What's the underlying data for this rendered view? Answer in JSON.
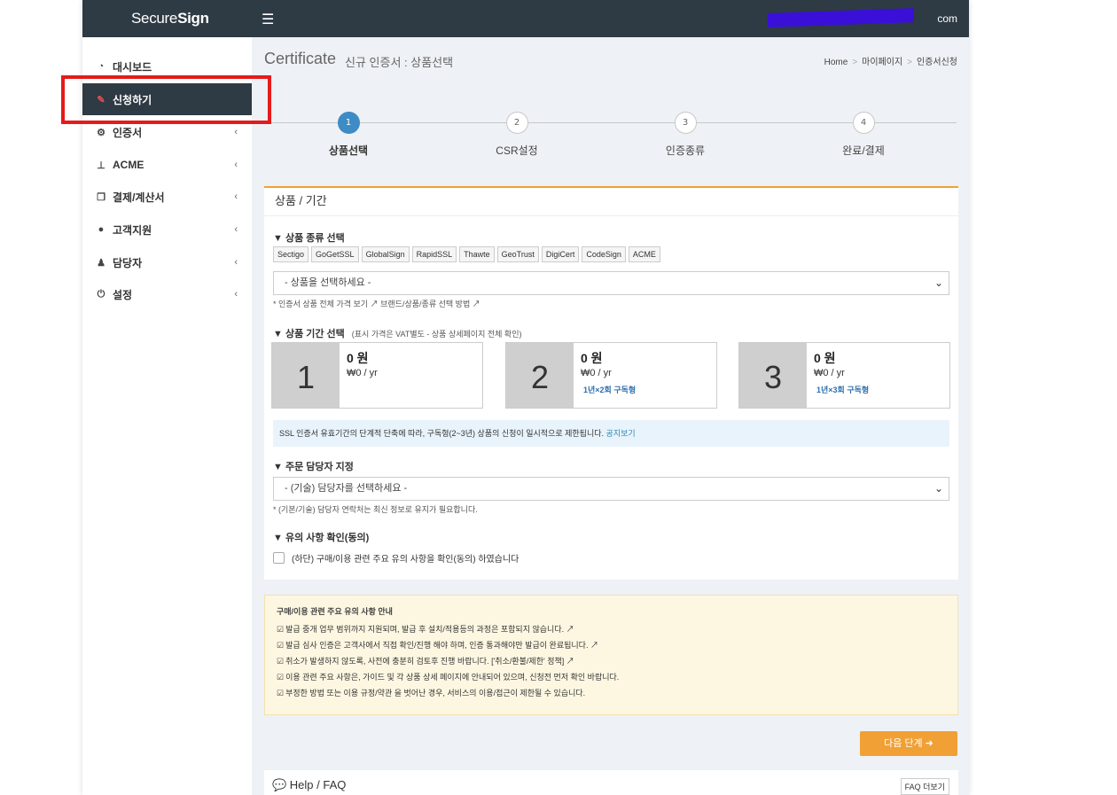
{
  "header": {
    "logo_light": "Secure",
    "logo_bold": "Sign",
    "menu_icon": "hamburger-icon",
    "user_email_suffix": "com"
  },
  "sidebar": {
    "items": [
      {
        "label": "대시보드",
        "icon": "dashboard-icon",
        "has_chevron": false
      },
      {
        "label": "신청하기",
        "icon": "edit-icon",
        "has_chevron": false,
        "active": true
      },
      {
        "label": "인증서",
        "icon": "cogs-icon",
        "has_chevron": true
      },
      {
        "label": "ACME",
        "icon": "sitemap-icon",
        "has_chevron": true
      },
      {
        "label": "결제/계산서",
        "icon": "copy-icon",
        "has_chevron": true
      },
      {
        "label": "고객지원",
        "icon": "comments-icon",
        "has_chevron": true
      },
      {
        "label": "담당자",
        "icon": "users-icon",
        "has_chevron": true
      },
      {
        "label": "설정",
        "icon": "power-icon",
        "has_chevron": true
      }
    ]
  },
  "page": {
    "title": "Certificate",
    "subtitle": "신규 인증서 : 상품선택",
    "breadcrumb": [
      "Home",
      "마이페이지",
      "인증서신청"
    ]
  },
  "steps": [
    {
      "num": "1",
      "label": "상품선택",
      "active": true
    },
    {
      "num": "2",
      "label": "CSR설정",
      "active": false
    },
    {
      "num": "3",
      "label": "인증종류",
      "active": false
    },
    {
      "num": "4",
      "label": "완료/결제",
      "active": false
    }
  ],
  "form": {
    "panel_title": "상품 / 기간",
    "product_type_title": "▼ 상품 종류 선택",
    "brands": [
      "Sectigo",
      "GoGetSSL",
      "GlobalSign",
      "RapidSSL",
      "Thawte",
      "GeoTrust",
      "DigiCert",
      "CodeSign",
      "ACME"
    ],
    "product_select_value": "- 상품을 선택하세요 -",
    "product_hint_1": "* 인증서 상품 전체 가격 보기",
    "product_hint_2": "브랜드/상품/종류 선택 방법",
    "period_title": "▼ 상품 기간 선택",
    "period_note": "(표시 가격은 VAT별도 - 상품 상세페이지 전체 확인)",
    "periods": [
      {
        "num": "1",
        "price": "0 원",
        "per_year": "₩0 / yr",
        "sub": ""
      },
      {
        "num": "2",
        "price": "0 원",
        "per_year": "₩0 / yr",
        "sub": "1년×2회 구독형"
      },
      {
        "num": "3",
        "price": "0 원",
        "per_year": "₩0 / yr",
        "sub": "1년×3회 구독형"
      }
    ],
    "notice_text": "SSL 인증서 유효기간의 단계적 단축에 따라, 구독형(2~3년) 상품의 신청이 일시적으로 제한됩니다.",
    "notice_link": "공지보기",
    "contact_title": "▼ 주문 담당자 지정",
    "contact_select_value": "- (기술) 담당자를 선택하세요 -",
    "contact_hint": "* (기본/기술) 담당자 연락처는 최신 정보로 유지가 필요합니다.",
    "agree_title": "▼ 유의 사항 확인(동의)",
    "agree_label": "(하단) 구매/이용 관련 주요 유의 사항을 확인(동의) 하였습니다"
  },
  "caution": {
    "title": "구매/이용 관련 주요 유의 사항 안내",
    "items": [
      "발급 중개 업무 범위까지 지원되며, 발급 후 설치/적용등의 과정은 포함되지 않습니다.",
      "발급 심사 인증은 고객사에서 직접 확인/진행 해야 하며, 인증 통과해야만 발급이 완료됩니다.",
      "취소가 발생하지 않도록, 사전에 충분히 검토후 진행 바랍니다. ['취소/환불/제한' 정책]",
      "이용 관련 주요 사항은, 가이드 및 각 상품 상세 페이지에 안내되어 있으며, 신청전 먼저 확인 바랍니다.",
      "부정한 방법 또는 이용 규정/약관 을 벗어난 경우, 서비스의 이용/접근이 제한될 수 있습니다."
    ]
  },
  "actions": {
    "next_label": "다음 단계 ➜"
  },
  "help": {
    "title": "💬 Help / FAQ",
    "more_label": "FAQ 더보기"
  }
}
